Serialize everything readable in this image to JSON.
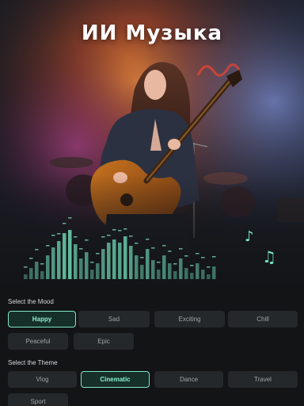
{
  "title": "ИИ Музыка",
  "accent": "#7fe5c4",
  "icons": {
    "note_single": "music-note-icon",
    "note_double": "music-notes-icon"
  },
  "mood": {
    "label": "Select the Mood",
    "selected": "Happy",
    "options": [
      "Happy",
      "Sad",
      "Exciting",
      "Chill",
      "Peaceful",
      "Epic"
    ]
  },
  "theme": {
    "label": "Select the Theme",
    "selected": "Cinematic",
    "options": [
      "Vlog",
      "Cinematic",
      "Dance",
      "Travel",
      "Sport"
    ]
  }
}
